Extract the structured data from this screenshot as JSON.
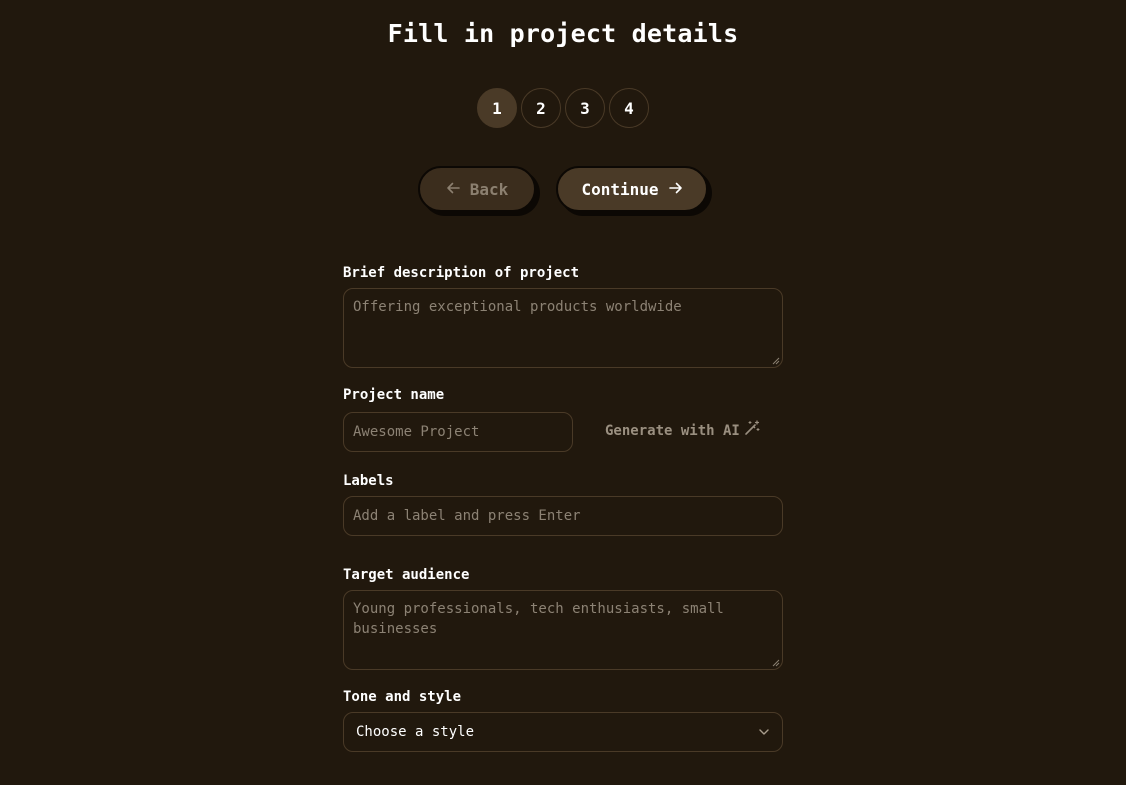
{
  "header": {
    "title": "Fill in project details"
  },
  "steps": [
    "1",
    "2",
    "3",
    "4"
  ],
  "nav": {
    "back_label": "Back",
    "continue_label": "Continue"
  },
  "form": {
    "description": {
      "label": "Brief description of project",
      "placeholder": "Offering exceptional products worldwide"
    },
    "project_name": {
      "label": "Project name",
      "placeholder": "Awesome Project",
      "generate_label": "Generate with AI"
    },
    "labels": {
      "label": "Labels",
      "placeholder": "Add a label and press Enter"
    },
    "audience": {
      "label": "Target audience",
      "placeholder_line1": "Young professionals, tech enthusiasts, small",
      "placeholder_line2": "businesses"
    },
    "tone": {
      "label": "Tone and style",
      "selected": "Choose a style"
    }
  },
  "icons": {
    "back": "arrow-left-icon",
    "continue": "arrow-right-icon",
    "generate": "magic-wand-icon",
    "select": "chevron-down-icon"
  },
  "colors": {
    "background": "#21180d",
    "accent": "#4a3a27",
    "border": "#4a3a27",
    "placeholder": "#8c8274"
  }
}
